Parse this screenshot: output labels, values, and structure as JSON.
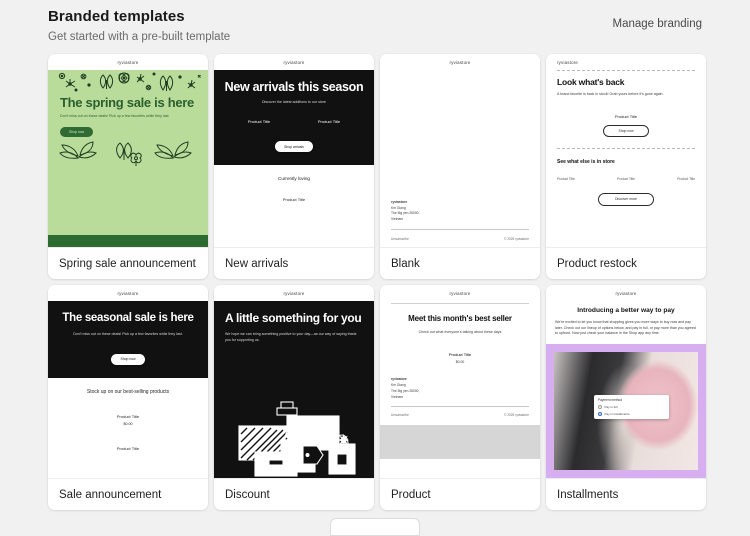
{
  "header": {
    "title": "Branded templates",
    "subtitle": "Get started with a pre-built template",
    "manage_link": "Manage branding"
  },
  "brand": {
    "store_name": "ryviastore",
    "address_name": "ryviastore",
    "address_line1": "Km Giang",
    "address_line2": "The Mg yen 26000,",
    "address_line3": "Vietnam",
    "unsubscribe": "Unsubscribe",
    "copyright": "© 2025 ryviastore"
  },
  "colors": {
    "page_background": "#f1f1f1",
    "card_background": "#ffffff",
    "spring_green": "#b9dc9b",
    "spring_dark_green": "#2e6b32",
    "dark_hero": "#111111",
    "installments_purple": "#d7aef0",
    "radio_blue": "#2c6ecb"
  },
  "templates": [
    {
      "label": "Spring sale announcement",
      "store": "ryviastore",
      "heading": "The spring sale is here",
      "body": "Don't miss out on these deals! Pick up a few favorites while they last.",
      "cta": "Shop now"
    },
    {
      "label": "New arrivals",
      "store": "ryviastore",
      "heading": "New arrivals this season",
      "body": "Discover the latest additions to our store",
      "product_left": "Product Title",
      "product_right": "Product Title",
      "cta": "Shop arrivals",
      "section_heading": "Currently loving",
      "product_title": "Product Title"
    },
    {
      "label": "Blank",
      "store": "ryviastore"
    },
    {
      "label": "Product restock",
      "store": "ryviastore",
      "heading": "Look what's back",
      "body": "A brand favorite is back in stock! Grab yours before it's gone again.",
      "product_title": "Product Title",
      "cta": "Shop now",
      "section_heading": "See what else is in store",
      "trio": [
        "Product Title",
        "Product Title",
        "Product Title"
      ],
      "cta2": "Discover more"
    },
    {
      "label": "Sale announcement",
      "store": "ryviastore",
      "heading": "The seasonal sale is here",
      "body": "Don't miss out on these deals! Pick up a few favorites while they last.",
      "cta": "Shop now",
      "section_heading": "Stock up on our best-selling products",
      "product_title": "Product Title",
      "price": "$0.00",
      "product_title_2": "Product Title"
    },
    {
      "label": "Discount",
      "store": "ryviastore",
      "heading": "A little something for you",
      "body": "We hope we can bring something positive to your day—as our way of saying thank you for supporting us."
    },
    {
      "label": "Product",
      "store": "ryviastore",
      "heading": "Meet this month's best seller",
      "body": "Check out what everyone's talking about these days",
      "product_title": "Product Title",
      "price": "$0.00"
    },
    {
      "label": "Installments",
      "store": "ryviastore",
      "heading": "Introducing a better way to pay",
      "body": "We're excited to let you know that shopping gives you more ways to buy now and pay later. Check out our lineup of options below, and pay in full, or pay more than you agreed to upfront. Now just check your balance in the Shop app any time.",
      "popup_title": "Payment method",
      "option_1": "Pay in full",
      "option_2": "Pay in installments"
    }
  ]
}
